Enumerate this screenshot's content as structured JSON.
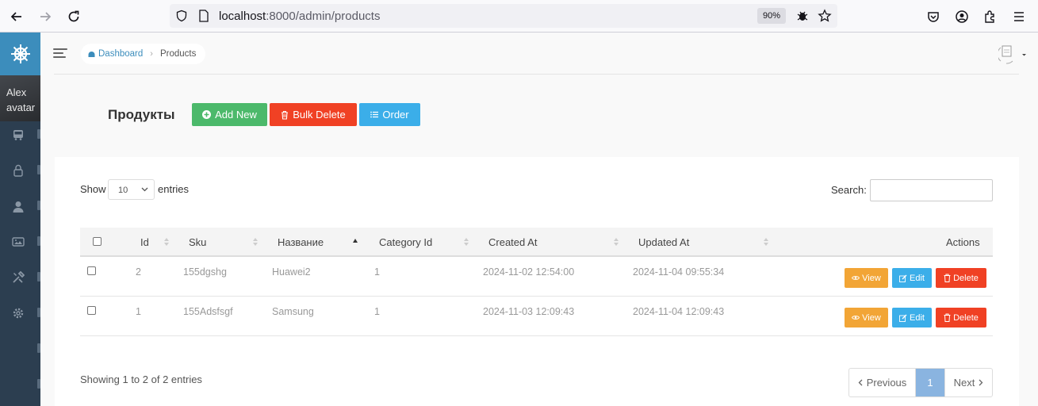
{
  "browser": {
    "url_host": "localhost",
    "url_rest": ":8000/admin/products",
    "zoom": "90%"
  },
  "sidebar": {
    "avatar_text_1": "Alex",
    "avatar_text_2": "avatar",
    "items": [
      {
        "icon": "bus-icon"
      },
      {
        "icon": "lock-icon"
      },
      {
        "icon": "user-icon"
      },
      {
        "icon": "images-icon"
      },
      {
        "icon": "tools-icon"
      },
      {
        "icon": "gear-icon"
      }
    ]
  },
  "breadcrumb": {
    "home": "Dashboard",
    "current": "Products"
  },
  "page": {
    "title": "Продукты",
    "add_label": "Add New",
    "bulk_label": "Bulk Delete",
    "order_label": "Order"
  },
  "table_controls": {
    "show": "Show",
    "entries_value": "10",
    "entries": "entries",
    "search": "Search:"
  },
  "table": {
    "headers": [
      "Id",
      "Sku",
      "Название",
      "Category Id",
      "Created At",
      "Updated At",
      "Actions"
    ],
    "rows": [
      {
        "id": "2",
        "sku": "155dgshg",
        "name": "Huawei2",
        "category_id": "1",
        "created_at": "2024-11-02 12:54:00",
        "updated_at": "2024-11-04 09:55:34"
      },
      {
        "id": "1",
        "sku": "155Adsfsgf",
        "name": "Samsung",
        "category_id": "1",
        "created_at": "2024-11-03 12:09:43",
        "updated_at": "2024-11-04 12:09:43"
      }
    ],
    "actions": {
      "view": "View",
      "edit": "Edit",
      "delete": "Delete"
    }
  },
  "footer": {
    "info": "Showing 1 to 2 of 2 entries",
    "previous": "Previous",
    "page": "1",
    "next": "Next"
  },
  "colors": {
    "sidebar": "#2c3e50",
    "brand": "#3c8dbc",
    "success": "#4cb96b",
    "danger": "#f04124",
    "info": "#3baee9",
    "warning": "#f2a536"
  }
}
